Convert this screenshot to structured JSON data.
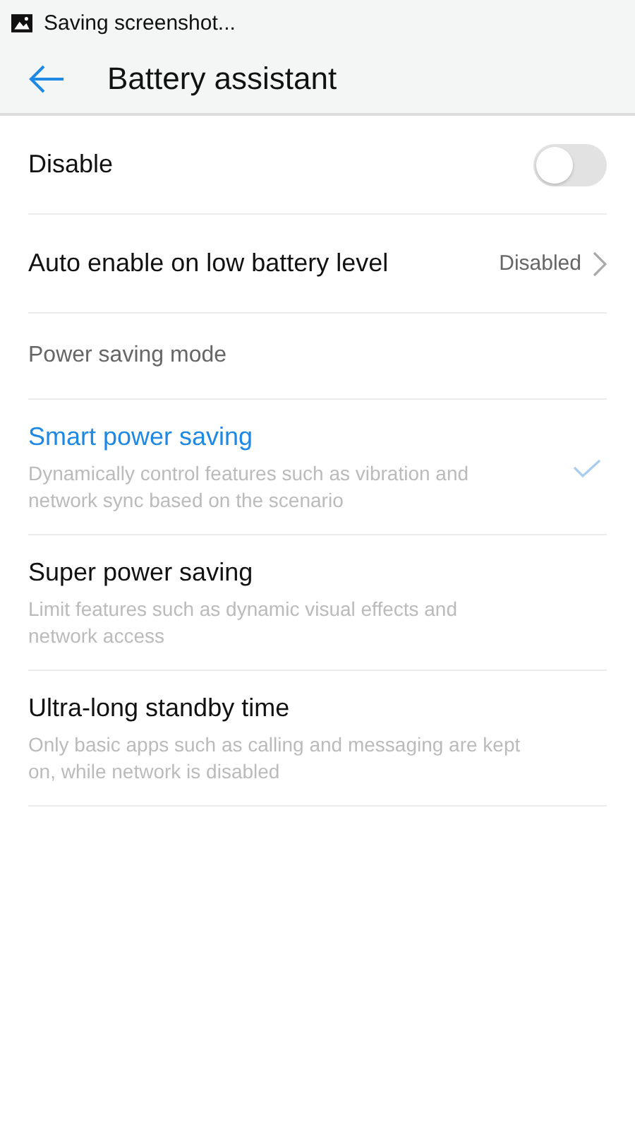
{
  "status_bar": {
    "notification": "Saving screenshot..."
  },
  "header": {
    "title": "Battery assistant"
  },
  "settings": [
    {
      "kind": "toggle",
      "label": "Disable",
      "on": false
    },
    {
      "kind": "link",
      "label": "Auto enable on low battery level",
      "value": "Disabled"
    }
  ],
  "power_saving": {
    "heading": "Power saving mode",
    "modes": [
      {
        "title": "Smart power saving",
        "description": "Dynamically control features such as vibration and network sync based on the scenario",
        "selected": true
      },
      {
        "title": "Super power saving",
        "description": "Limit features such as dynamic visual effects and network access",
        "selected": false
      },
      {
        "title": "Ultra-long standby time",
        "description": "Only basic apps such as calling and messaging are kept on, while network is disabled",
        "selected": false
      }
    ]
  }
}
